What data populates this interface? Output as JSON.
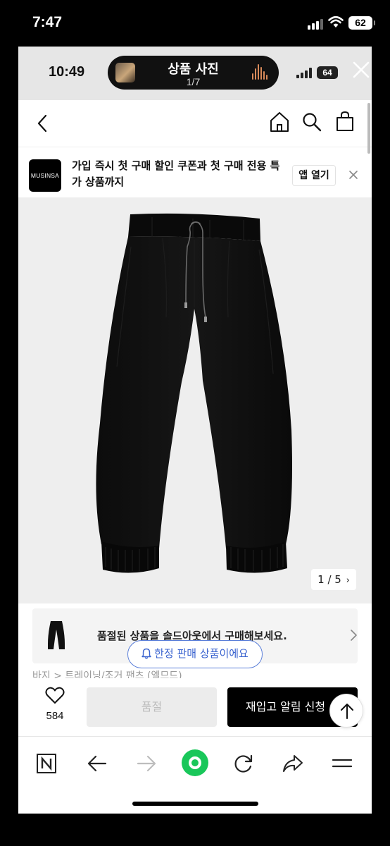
{
  "outer_status": {
    "time": "7:47",
    "battery": "62"
  },
  "inner_status": {
    "time": "10:49",
    "battery": "64",
    "activity_title": "상품 사진",
    "activity_counter": "1/7"
  },
  "banner": {
    "logo_text": "MUSINSA",
    "message": "가입 즉시 첫 구매 할인 쿠폰과 첫 구매 전용 특가 상품까지",
    "open_app_label": "앱 열기"
  },
  "product": {
    "image_counter": "1 / 5",
    "image_index": 1,
    "image_total": 5
  },
  "soldout_card": {
    "text": "품절된 상품을 솔드아웃에서 구매해보세요."
  },
  "limited_badge": "한정 판매 상품이에요",
  "breadcrumb": "바지 > 트레이닝/조거 팬츠 (엘므드)",
  "buy_bar": {
    "like_count": "584",
    "soldout_label": "품절",
    "restock_label": "재입고 알림 신청"
  },
  "colors": {
    "accent_blue": "#3a63cf",
    "toolbar_green": "#19c75a",
    "primary_black": "#000000"
  },
  "icons": {
    "nav": [
      "back-icon",
      "home-icon",
      "search-icon",
      "cart-icon"
    ],
    "toolbar": [
      "naver-n-icon",
      "back-arrow-icon",
      "forward-arrow-icon",
      "green-dot-icon",
      "refresh-icon",
      "share-icon",
      "menu-icon"
    ]
  }
}
